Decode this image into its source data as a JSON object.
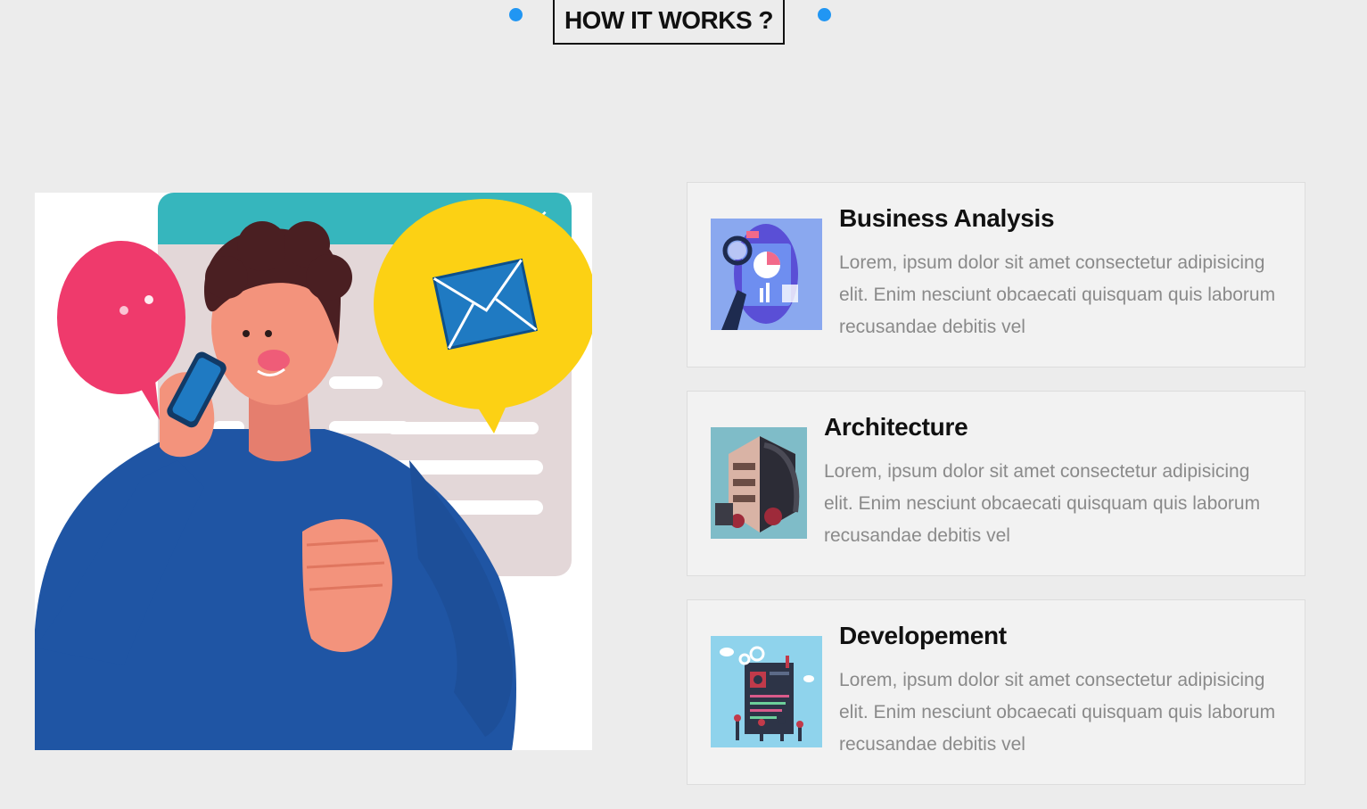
{
  "section": {
    "title": "HOW IT WORKS ?",
    "accent_color": "#2196f3"
  },
  "hero_image": {
    "description_icon": "person-on-phone-illustration"
  },
  "cards": [
    {
      "title": "Business Analysis",
      "description": "Lorem, ipsum dolor sit amet consectetur adipisicing elit. Enim nesciunt obcaecati quisquam quis laborum recusandae debitis vel",
      "icon": "business-analysis-illustration"
    },
    {
      "title": "Architecture",
      "description": "Lorem, ipsum dolor sit amet consectetur adipisicing elit. Enim nesciunt obcaecati quisquam quis laborum recusandae debitis vel",
      "icon": "architecture-illustration"
    },
    {
      "title": "Developement",
      "description": "Lorem, ipsum dolor sit amet consectetur adipisicing elit. Enim nesciunt obcaecati quisquam quis laborum recusandae debitis vel",
      "icon": "development-illustration"
    }
  ]
}
